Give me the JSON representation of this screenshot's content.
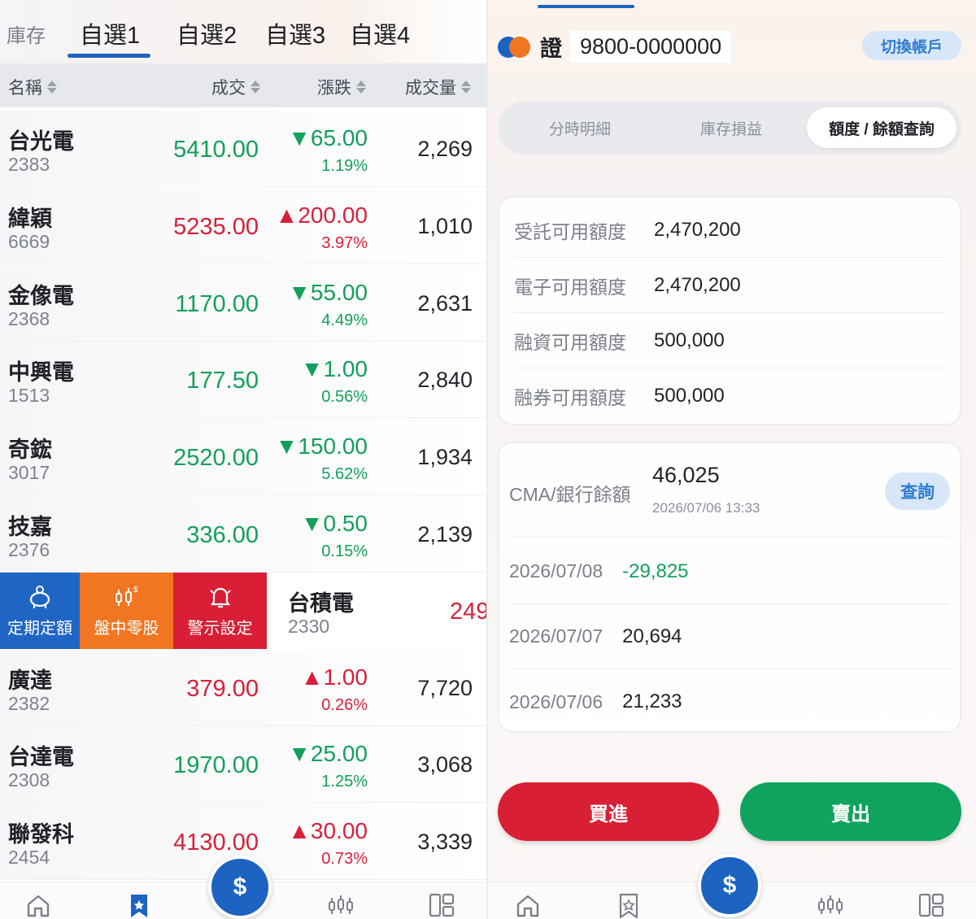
{
  "left": {
    "tabs": [
      {
        "label": "庫存"
      },
      {
        "label": "自選1"
      },
      {
        "label": "自選2"
      },
      {
        "label": "自選3"
      },
      {
        "label": "自選4"
      }
    ],
    "columns": {
      "name": "名稱",
      "price": "成交",
      "change": "漲跌",
      "volume": "成交量"
    },
    "rows": [
      {
        "name": "台光電",
        "code": "2383",
        "price": "5410.00",
        "change": "▼65.00",
        "pct": "1.19%",
        "volume": "2,269",
        "dir": "down"
      },
      {
        "name": "緯穎",
        "code": "6669",
        "price": "5235.00",
        "change": "▲200.00",
        "pct": "3.97%",
        "volume": "1,010",
        "dir": "up"
      },
      {
        "name": "金像電",
        "code": "2368",
        "price": "1170.00",
        "change": "▼55.00",
        "pct": "4.49%",
        "volume": "2,631",
        "dir": "down"
      },
      {
        "name": "中興電",
        "code": "1513",
        "price": "177.50",
        "change": "▼1.00",
        "pct": "0.56%",
        "volume": "2,840",
        "dir": "down"
      },
      {
        "name": "奇鋐",
        "code": "3017",
        "price": "2520.00",
        "change": "▼150.00",
        "pct": "5.62%",
        "volume": "1,934",
        "dir": "down"
      },
      {
        "name": "技嘉",
        "code": "2376",
        "price": "336.00",
        "change": "▼0.50",
        "pct": "0.15%",
        "volume": "2,139",
        "dir": "down"
      },
      {
        "name": "廣達",
        "code": "2382",
        "price": "379.00",
        "change": "▲1.00",
        "pct": "0.26%",
        "volume": "7,720",
        "dir": "up"
      },
      {
        "name": "台達電",
        "code": "2308",
        "price": "1970.00",
        "change": "▼25.00",
        "pct": "1.25%",
        "volume": "3,068",
        "dir": "down"
      },
      {
        "name": "聯發科",
        "code": "2454",
        "price": "4130.00",
        "change": "▲30.00",
        "pct": "0.73%",
        "volume": "3,339",
        "dir": "up"
      }
    ],
    "swipe": {
      "actions": [
        "定期定額",
        "盤中零股",
        "警示設定"
      ],
      "name": "台積電",
      "code": "2330",
      "price_partial": "249"
    },
    "fab_label": "$"
  },
  "right": {
    "account_label": "證",
    "account_no": "9800-0000000",
    "switch_label": "切換帳戶",
    "segments": [
      "分時明細",
      "庫存損益",
      "額度 / 餘額查詢"
    ],
    "quota": [
      {
        "label": "受託可用額度",
        "value": "2,470,200"
      },
      {
        "label": "電子可用額度",
        "value": "2,470,200"
      },
      {
        "label": "融資可用額度",
        "value": "500,000"
      },
      {
        "label": "融券可用額度",
        "value": "500,000"
      }
    ],
    "bank": {
      "label": "CMA/銀行餘額",
      "value": "46,025",
      "time": "2026/07/06 13:33",
      "query_label": "查詢"
    },
    "history": [
      {
        "date": "2026/07/08",
        "value": "-29,825",
        "neg": true
      },
      {
        "date": "2026/07/07",
        "value": "20,694",
        "neg": false
      },
      {
        "date": "2026/07/06",
        "value": "21,233",
        "neg": false
      }
    ],
    "buy_label": "買進",
    "sell_label": "賣出",
    "fab_label": "$"
  },
  "colors": {
    "accent": "#1d63c2",
    "up": "#d8203a",
    "down": "#12a05a",
    "orange": "#f07622"
  }
}
